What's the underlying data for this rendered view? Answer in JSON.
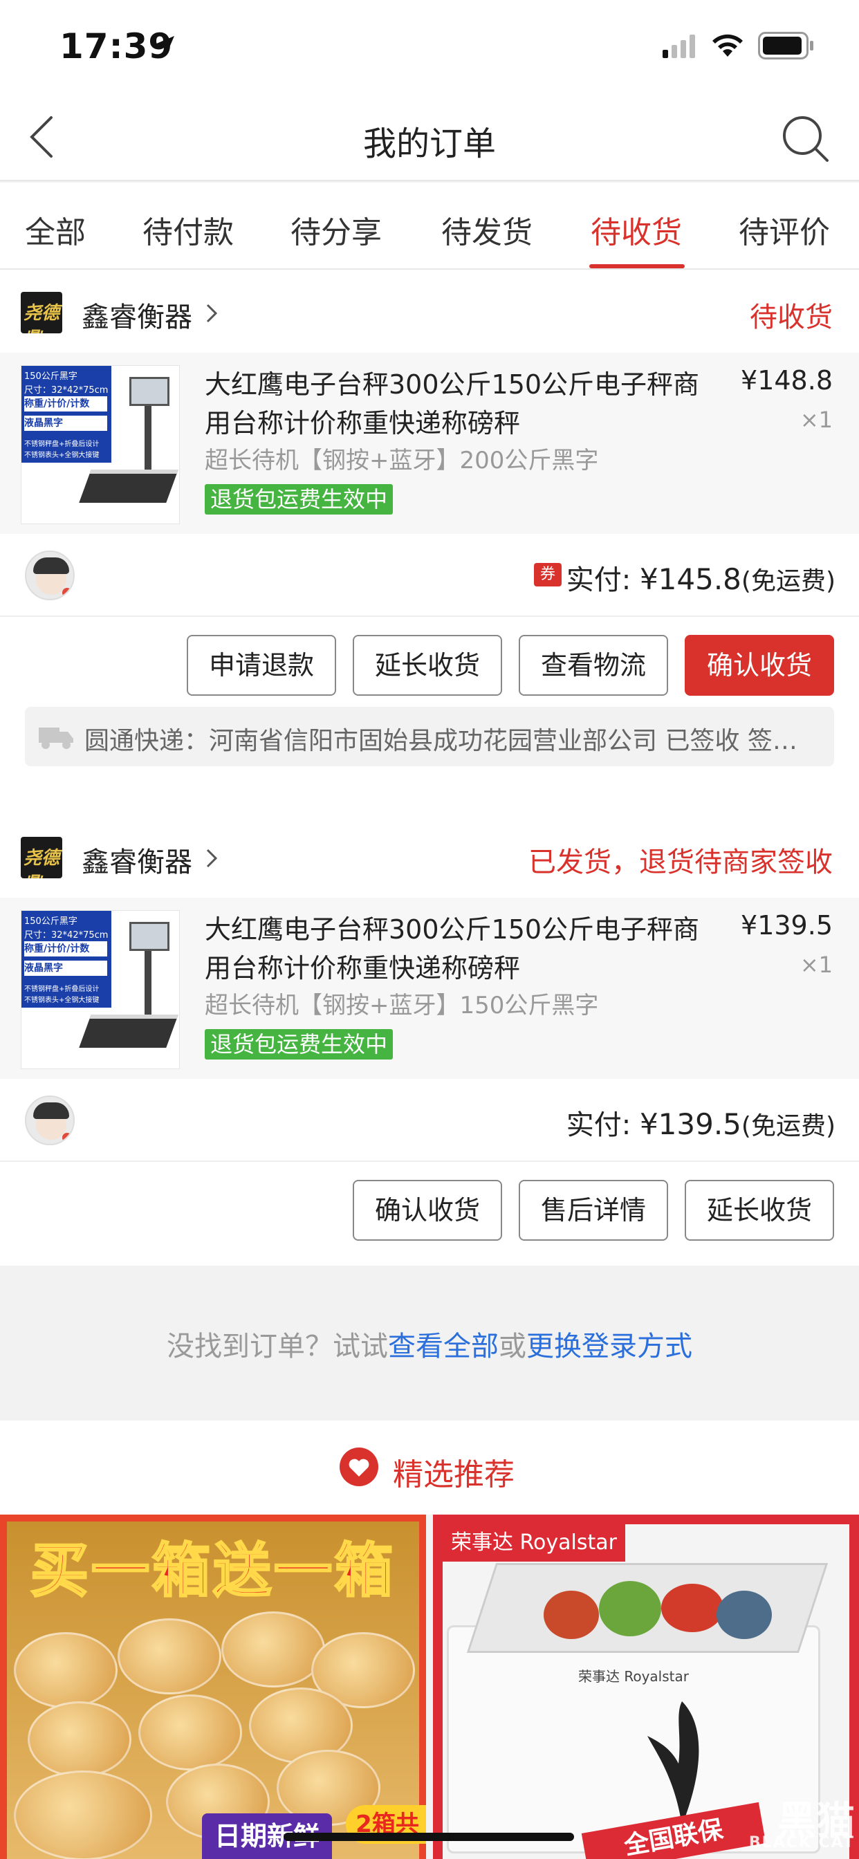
{
  "status_bar": {
    "time": "17:39"
  },
  "nav": {
    "title": "我的订单"
  },
  "tabs": [
    {
      "label": "全部"
    },
    {
      "label": "待付款"
    },
    {
      "label": "待分享"
    },
    {
      "label": "待发货"
    },
    {
      "label": "待收货",
      "active": true
    },
    {
      "label": "待评价"
    }
  ],
  "orders": [
    {
      "shop": {
        "name": "鑫睿衡器",
        "logo_text": "尧德鼎"
      },
      "status": "待收货",
      "item": {
        "title": "大红鹰电子台秤300公斤150公斤电子秤商用台称计价称重快递称磅秤",
        "spec": "超长待机【钢按+蓝牙】200公斤黑字",
        "badge": "退货包运费生效中",
        "price": "¥148.8",
        "qty": "×1",
        "thumb_lines": [
          "150公斤黑字",
          "尺寸：32*42*75cm",
          "称重/计价/计数",
          "液晶黑字",
          "不锈钢秤盘+折叠后设计",
          "不锈钢表头+全钢大接键"
        ]
      },
      "coupon_icon": "券",
      "pay": {
        "label": "实付: ",
        "amount": "¥145.8",
        "note": "(免运费)"
      },
      "buttons": [
        {
          "label": "申请退款"
        },
        {
          "label": "延长收货"
        },
        {
          "label": "查看物流"
        },
        {
          "label": "确认收货",
          "primary": true
        }
      ],
      "logistics": "圆通快递：河南省信阳市固始县成功花园营业部公司 已签收 签收人：..."
    },
    {
      "shop": {
        "name": "鑫睿衡器",
        "logo_text": "尧德鼎"
      },
      "status": "已发货，退货待商家签收",
      "item": {
        "title": "大红鹰电子台秤300公斤150公斤电子秤商用台称计价称重快递称磅秤",
        "spec": "超长待机【钢按+蓝牙】150公斤黑字",
        "badge": "退货包运费生效中",
        "price": "¥139.5",
        "qty": "×1",
        "thumb_lines": [
          "150公斤黑字",
          "尺寸：32*42*75cm",
          "称重/计价/计数",
          "液晶黑字",
          "不锈钢秤盘+折叠后设计",
          "不锈钢表头+全钢大接键"
        ]
      },
      "pay": {
        "label": "实付: ",
        "amount": "¥139.5",
        "note": "(免运费)"
      },
      "buttons": [
        {
          "label": "确认收货"
        },
        {
          "label": "售后详情"
        },
        {
          "label": "延长收货"
        }
      ]
    }
  ],
  "hint": {
    "prefix": "没找到订单？试试",
    "link1": "查看全部",
    "middle": "或",
    "link2": "更换登录方式"
  },
  "recommend": {
    "title": "精选推荐",
    "products": [
      {
        "promo": "买一箱送一箱",
        "tag": "日期新鲜",
        "tag2": "2箱共"
      },
      {
        "brand": "荣事达 Royalstar",
        "label": "荣事达 Royalstar",
        "tag": "全国联保"
      }
    ]
  },
  "watermark": {
    "text": "黑猫",
    "sub": "BLACK CAT"
  },
  "colors": {
    "accent": "#d9322c",
    "badge_green": "#45b441",
    "link_blue": "#2a6fdb"
  }
}
